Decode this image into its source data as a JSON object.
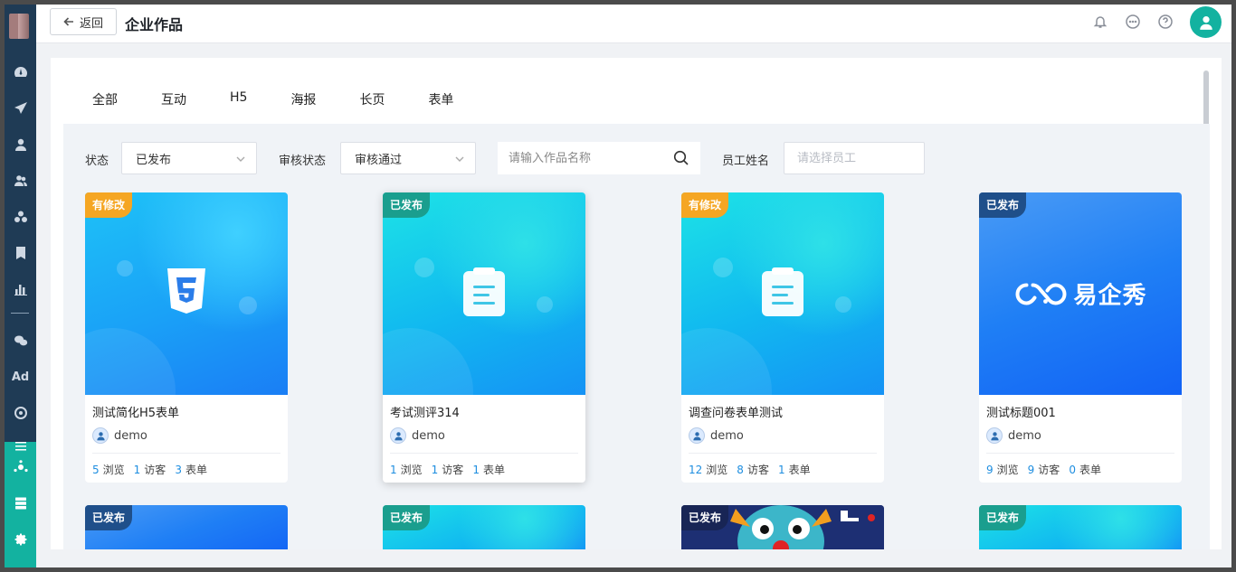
{
  "header": {
    "back_label": "返回",
    "title": "企业作品"
  },
  "tabs": [
    {
      "label": "全部"
    },
    {
      "label": "互动"
    },
    {
      "label": "H5"
    },
    {
      "label": "海报"
    },
    {
      "label": "长页"
    },
    {
      "label": "表单"
    }
  ],
  "filters": {
    "status_label": "状态",
    "status_value": "已发布",
    "review_label": "审核状态",
    "review_value": "审核通过",
    "search_placeholder": "请输入作品名称",
    "employee_label": "员工姓名",
    "employee_placeholder": "请选择员工"
  },
  "stat_labels": {
    "views": "浏览",
    "visitors": "访客",
    "forms": "表单"
  },
  "cards": [
    {
      "badge": "有修改",
      "title": "测试简化H5表单",
      "author": "demo",
      "views": "5",
      "visitors": "1",
      "forms": "3",
      "cover_icon": "html5-icon"
    },
    {
      "badge": "已发布",
      "title": "考试测评314",
      "author": "demo",
      "views": "1",
      "visitors": "1",
      "forms": "1",
      "cover_icon": "clipboard-icon"
    },
    {
      "badge": "有修改",
      "title": "调查问卷表单测试",
      "author": "demo",
      "views": "12",
      "visitors": "8",
      "forms": "1",
      "cover_icon": "clipboard-icon"
    },
    {
      "badge": "已发布",
      "title": "测试标题001",
      "author": "demo",
      "views": "9",
      "visitors": "9",
      "forms": "0",
      "cover_icon": "brand-logo",
      "brand_text": "易企秀"
    }
  ],
  "cards_row2": [
    {
      "badge": "已发布"
    },
    {
      "badge": "已发布"
    },
    {
      "badge": "已发布"
    },
    {
      "badge": "已发布"
    }
  ],
  "sidebar": {
    "ad_label": "Ad"
  },
  "colors": {
    "accent": "#13b2a0",
    "sidebar": "#1f3b55",
    "modified_badge": "#f5a623",
    "published_badge": "#1a9e8e",
    "stat_number": "#1e8ee0"
  }
}
